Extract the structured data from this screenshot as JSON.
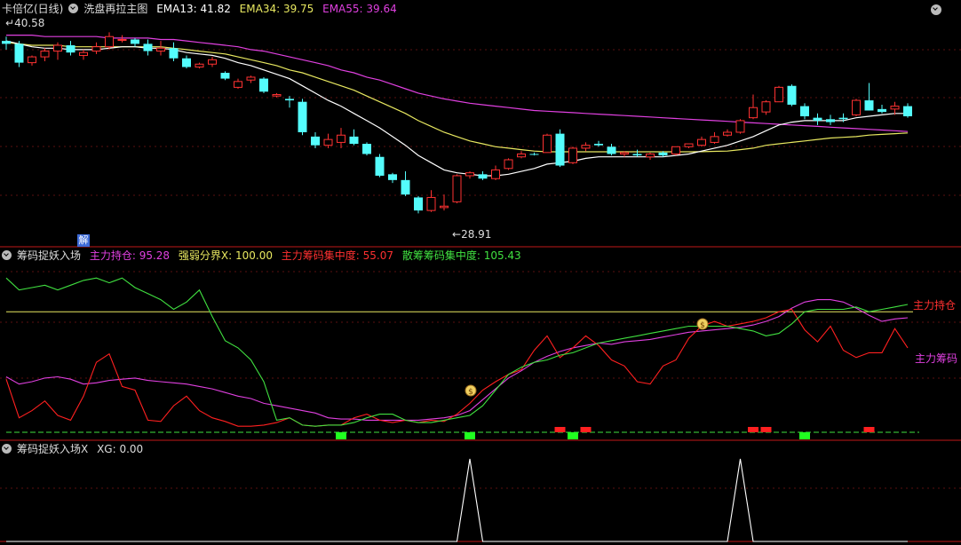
{
  "main_panel": {
    "title": "卡倍亿(日线)",
    "indicator": "洗盘再拉主图",
    "ema13": "EMA13: 41.82",
    "ema34": "EMA34: 39.75",
    "ema55": "EMA55: 39.64",
    "high_label": "40.58",
    "low_label": "28.91",
    "jie_label": "解"
  },
  "mid_panel": {
    "name": "筹码捉妖入场",
    "zhuli_chicang": "主力持仓: 95.28",
    "qiangruo": "强弱分界X: 100.00",
    "zhuli_jizhong": "主力筹码集中度: 55.07",
    "sanchou_jizhong": "散筹筹码集中度: 105.43",
    "right_label_1": "主力持仓",
    "right_label_2": "主力筹码"
  },
  "bottom_panel": {
    "name": "筹码捉妖入场X",
    "xg": "XG: 0.00"
  },
  "colors": {
    "up": "#ff3232",
    "down": "#54fcfc",
    "ema13": "#ffffff",
    "ema34": "#e8e860",
    "ema55": "#e040e0",
    "zhuli": "#ff2020",
    "sanchou": "#40e040",
    "chicang": "#e040e0",
    "threshold": "#e8e860",
    "separator": "#c01818"
  },
  "chart_data": [
    {
      "type": "candlestick",
      "title": "卡倍亿(日线)",
      "ylim": [
        27.5,
        42.2
      ],
      "ohlc": [
        [
          40.6,
          40.9,
          40.0,
          40.4
        ],
        [
          40.4,
          40.6,
          38.8,
          39.1
        ],
        [
          39.1,
          39.6,
          38.9,
          39.5
        ],
        [
          39.5,
          40.1,
          39.2,
          39.9
        ],
        [
          39.9,
          40.5,
          39.3,
          40.3
        ],
        [
          40.3,
          40.6,
          39.6,
          39.8
        ],
        [
          39.6,
          40.0,
          39.3,
          39.8
        ],
        [
          39.9,
          40.5,
          39.7,
          40.2
        ],
        [
          40.2,
          41.2,
          40.0,
          40.9
        ],
        [
          40.7,
          41.0,
          40.5,
          40.7
        ],
        [
          40.7,
          40.8,
          40.2,
          40.4
        ],
        [
          40.4,
          40.7,
          39.6,
          39.9
        ],
        [
          39.9,
          40.6,
          39.6,
          40.1
        ],
        [
          40.1,
          40.5,
          39.2,
          39.4
        ],
        [
          39.4,
          39.6,
          38.7,
          38.8
        ],
        [
          38.8,
          39.1,
          38.7,
          39.0
        ],
        [
          39.0,
          39.5,
          38.8,
          39.3
        ],
        [
          38.4,
          38.5,
          37.9,
          38.0
        ],
        [
          37.4,
          38.0,
          37.3,
          37.8
        ],
        [
          37.9,
          38.2,
          37.7,
          38.1
        ],
        [
          38.0,
          38.1,
          37.0,
          37.1
        ],
        [
          36.8,
          37.0,
          36.7,
          36.9
        ],
        [
          36.6,
          36.8,
          36.0,
          36.5
        ],
        [
          36.4,
          36.6,
          34.1,
          34.3
        ],
        [
          34.0,
          34.3,
          33.2,
          33.4
        ],
        [
          33.4,
          34.2,
          33.2,
          33.8
        ],
        [
          33.6,
          34.6,
          33.2,
          34.1
        ],
        [
          34.0,
          34.5,
          33.4,
          33.5
        ],
        [
          33.5,
          33.6,
          32.7,
          32.8
        ],
        [
          32.6,
          32.8,
          31.2,
          31.3
        ],
        [
          31.4,
          31.5,
          30.8,
          31.0
        ],
        [
          31.0,
          31.6,
          29.9,
          30.0
        ],
        [
          29.8,
          29.9,
          28.7,
          28.9
        ],
        [
          28.9,
          30.3,
          28.8,
          29.8
        ],
        [
          29.1,
          30.0,
          28.9,
          29.2
        ],
        [
          29.5,
          31.4,
          29.4,
          31.3
        ],
        [
          31.3,
          31.6,
          31.1,
          31.5
        ],
        [
          31.4,
          31.6,
          31.0,
          31.1
        ],
        [
          31.1,
          32.0,
          31.0,
          31.7
        ],
        [
          31.8,
          32.5,
          31.7,
          32.4
        ],
        [
          32.6,
          33.0,
          32.5,
          32.8
        ],
        [
          32.8,
          32.9,
          32.7,
          32.75
        ],
        [
          32.9,
          34.2,
          32.9,
          34.1
        ],
        [
          34.2,
          34.5,
          31.9,
          32.0
        ],
        [
          32.2,
          33.3,
          32.1,
          33.2
        ],
        [
          33.2,
          33.6,
          33.0,
          33.4
        ],
        [
          33.5,
          33.7,
          33.3,
          33.4
        ],
        [
          33.3,
          33.5,
          32.7,
          32.8
        ],
        [
          32.8,
          33.0,
          32.6,
          32.9
        ],
        [
          32.8,
          33.1,
          32.6,
          32.7
        ],
        [
          32.6,
          32.9,
          32.4,
          32.8
        ],
        [
          32.9,
          33.0,
          32.6,
          32.7
        ],
        [
          32.8,
          33.3,
          32.7,
          33.3
        ],
        [
          33.3,
          33.5,
          33.2,
          33.5
        ],
        [
          33.4,
          34.0,
          33.3,
          33.8
        ],
        [
          33.6,
          34.3,
          33.5,
          34.0
        ],
        [
          34.1,
          34.5,
          34.0,
          34.3
        ],
        [
          34.3,
          35.2,
          34.2,
          35.1
        ],
        [
          35.3,
          36.9,
          35.2,
          36.0
        ],
        [
          35.7,
          36.5,
          35.5,
          36.4
        ],
        [
          36.4,
          37.5,
          36.4,
          37.4
        ],
        [
          37.5,
          37.6,
          36.1,
          36.2
        ],
        [
          36.1,
          36.3,
          35.2,
          35.4
        ],
        [
          35.3,
          35.6,
          34.8,
          35.1
        ],
        [
          35.2,
          35.5,
          34.8,
          35.0
        ],
        [
          35.3,
          35.6,
          35.0,
          35.2
        ],
        [
          35.5,
          36.6,
          35.4,
          36.5
        ],
        [
          36.5,
          37.7,
          35.8,
          35.8
        ],
        [
          35.9,
          36.2,
          35.6,
          35.7
        ],
        [
          35.9,
          36.4,
          35.5,
          36.1
        ],
        [
          36.1,
          36.3,
          35.3,
          35.4
        ]
      ],
      "ema13": [
        40.6,
        40.4,
        40.2,
        40.1,
        40.1,
        40.0,
        40.0,
        40.0,
        40.1,
        40.2,
        40.2,
        40.1,
        40.1,
        40.0,
        39.8,
        39.7,
        39.6,
        39.4,
        39.1,
        38.9,
        38.6,
        38.3,
        38.0,
        37.5,
        37.0,
        36.5,
        36.1,
        35.6,
        35.1,
        34.6,
        34.0,
        33.4,
        32.7,
        32.2,
        31.7,
        31.5,
        31.4,
        31.3,
        31.3,
        31.4,
        31.6,
        31.8,
        32.1,
        32.2,
        32.3,
        32.5,
        32.6,
        32.6,
        32.6,
        32.6,
        32.6,
        32.6,
        32.7,
        32.8,
        33.0,
        33.2,
        33.4,
        33.7,
        34.0,
        34.4,
        34.8,
        35.0,
        35.1,
        35.1,
        35.1,
        35.1,
        35.3,
        35.4,
        35.5,
        35.6,
        35.6
      ],
      "ema34": [
        40.5,
        40.4,
        40.3,
        40.3,
        40.3,
        40.2,
        40.2,
        40.2,
        40.2,
        40.2,
        40.2,
        40.2,
        40.2,
        40.1,
        40.0,
        39.9,
        39.8,
        39.7,
        39.5,
        39.3,
        39.1,
        38.9,
        38.6,
        38.4,
        38.1,
        37.8,
        37.5,
        37.2,
        36.8,
        36.4,
        36.0,
        35.6,
        35.1,
        34.7,
        34.3,
        34.0,
        33.7,
        33.5,
        33.3,
        33.2,
        33.1,
        33.0,
        32.95,
        32.95,
        32.95,
        32.95,
        32.95,
        32.95,
        32.95,
        32.95,
        32.95,
        32.95,
        32.95,
        32.95,
        32.96,
        32.98,
        33.0,
        33.1,
        33.2,
        33.4,
        33.5,
        33.6,
        33.7,
        33.8,
        33.9,
        33.95,
        34.0,
        34.1,
        34.15,
        34.2,
        34.25
      ],
      "ema55": [
        41.0,
        41.0,
        41.0,
        40.9,
        40.9,
        40.9,
        40.9,
        40.9,
        40.8,
        40.8,
        40.8,
        40.8,
        40.7,
        40.7,
        40.6,
        40.5,
        40.4,
        40.3,
        40.2,
        40.0,
        39.9,
        39.7,
        39.5,
        39.3,
        39.1,
        38.9,
        38.6,
        38.4,
        38.1,
        37.9,
        37.6,
        37.3,
        37.0,
        36.8,
        36.6,
        36.45,
        36.3,
        36.2,
        36.1,
        36.0,
        35.9,
        35.8,
        35.75,
        35.7,
        35.65,
        35.6,
        35.55,
        35.5,
        35.45,
        35.4,
        35.35,
        35.3,
        35.25,
        35.2,
        35.15,
        35.1,
        35.05,
        35.0,
        34.95,
        34.9,
        34.85,
        34.8,
        34.75,
        34.7,
        34.65,
        34.6,
        34.55,
        34.5,
        34.45,
        34.4,
        34.35
      ],
      "annotations": [
        "40.58",
        "28.91",
        "解"
      ]
    },
    {
      "type": "line",
      "title": "筹码捉妖入场",
      "ylim": [
        0,
        148
      ],
      "threshold": 100,
      "series": [
        {
          "name": "主力持仓",
          "values": [
            46,
            40,
            42,
            45,
            46,
            44,
            40,
            41,
            43,
            44,
            45,
            43,
            42,
            41,
            40,
            38,
            36,
            33,
            30,
            28,
            24,
            22,
            20,
            18,
            16,
            12,
            11,
            11,
            10,
            10,
            10,
            10,
            10,
            11,
            12,
            14,
            18,
            27,
            36,
            45,
            51,
            58,
            63,
            67,
            70,
            72,
            74,
            73,
            75,
            76,
            77,
            79,
            81,
            83,
            84,
            85,
            86,
            87,
            89,
            92,
            96,
            103,
            108,
            110,
            110,
            108,
            103,
            97,
            92,
            94,
            95
          ]
        },
        {
          "name": "主力筹码集中度",
          "values": [
            44,
            12,
            18,
            26,
            14,
            10,
            30,
            58,
            65,
            38,
            35,
            10,
            9,
            22,
            30,
            18,
            12,
            9,
            5,
            5,
            6,
            8,
            12,
            6,
            5,
            6,
            6,
            12,
            15,
            10,
            8,
            10,
            8,
            10,
            9,
            15,
            24,
            35,
            42,
            48,
            52,
            68,
            80,
            62,
            70,
            80,
            72,
            60,
            55,
            42,
            40,
            55,
            60,
            78,
            88,
            92,
            88,
            90,
            92,
            95,
            100,
            102,
            85,
            75,
            88,
            68,
            62,
            66,
            66,
            86,
            70
          ]
        },
        {
          "name": "散筹筹码集中度",
          "values": [
            128,
            118,
            120,
            122,
            118,
            122,
            126,
            128,
            124,
            128,
            120,
            115,
            110,
            102,
            108,
            118,
            96,
            76,
            70,
            60,
            42,
            10,
            12,
            6,
            5,
            6,
            6,
            8,
            12,
            15,
            15,
            10,
            8,
            8,
            10,
            12,
            14,
            22,
            35,
            48,
            54,
            58,
            60,
            64,
            66,
            70,
            74,
            76,
            78,
            80,
            82,
            84,
            86,
            88,
            88,
            88,
            88,
            86,
            84,
            80,
            82,
            90,
            100,
            102,
            102,
            102,
            104,
            100,
            102,
            104,
            106
          ]
        }
      ],
      "right_labels": [
        "主力持仓",
        "主力筹码"
      ]
    },
    {
      "type": "line",
      "title": "筹码捉妖入场X",
      "series": [
        {
          "name": "XG",
          "values": [
            0,
            0,
            0,
            0,
            0,
            0,
            0,
            0,
            0,
            0,
            0,
            0,
            0,
            0,
            0,
            0,
            0,
            0,
            0,
            0,
            0,
            0,
            0,
            0,
            0,
            0,
            0,
            0,
            0,
            0,
            0,
            0,
            0,
            0,
            0,
            0,
            1,
            0,
            0,
            0,
            0,
            0,
            0,
            0,
            0,
            0,
            0,
            0,
            0,
            0,
            0,
            0,
            0,
            0,
            0,
            0,
            0,
            1,
            0,
            0,
            0,
            0,
            0,
            0,
            0,
            0,
            0,
            0,
            0,
            0,
            0
          ]
        }
      ],
      "ylim": [
        0,
        1
      ]
    }
  ]
}
